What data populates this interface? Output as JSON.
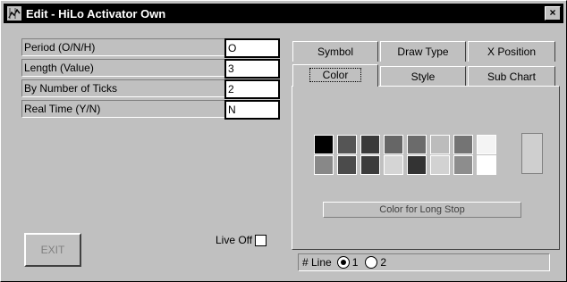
{
  "window": {
    "title": "Edit - HiLo Activator Own",
    "close_label": "×"
  },
  "fields": [
    {
      "label": "Period (O/N/H)",
      "value": "O"
    },
    {
      "label": "Length (Value)",
      "value": "3"
    },
    {
      "label": "By Number of Ticks",
      "value": "2"
    },
    {
      "label": "Real Time (Y/N)",
      "value": "N"
    }
  ],
  "exit_button": {
    "label": "EXIT",
    "enabled": false
  },
  "live_off": {
    "label": "Live Off",
    "checked": false
  },
  "tabs": {
    "back_row": [
      "Symbol",
      "Draw Type",
      "X Position"
    ],
    "front_row": [
      "Color",
      "Style",
      "Sub Chart"
    ],
    "selected": "Color"
  },
  "palette": {
    "row1": [
      "#000000",
      "#555555",
      "#3a3a3a",
      "#666666",
      "#6b6b6b",
      "#bcbcbc",
      "#747474",
      "#f4f4f4"
    ],
    "row2": [
      "#888888",
      "#4b4b4b",
      "#3c3c3c",
      "#d5d5d5",
      "#333333",
      "#d2d2d2",
      "#8d8d8d",
      "#ffffff"
    ],
    "selected_color": "#cfcfcf"
  },
  "color_target_label": "Color for Long Stop",
  "line": {
    "label": "# Line",
    "options": [
      "1",
      "2"
    ],
    "selected": "1"
  },
  "colors": {
    "background": "#c0c0c0",
    "titlebar": "#000000"
  }
}
